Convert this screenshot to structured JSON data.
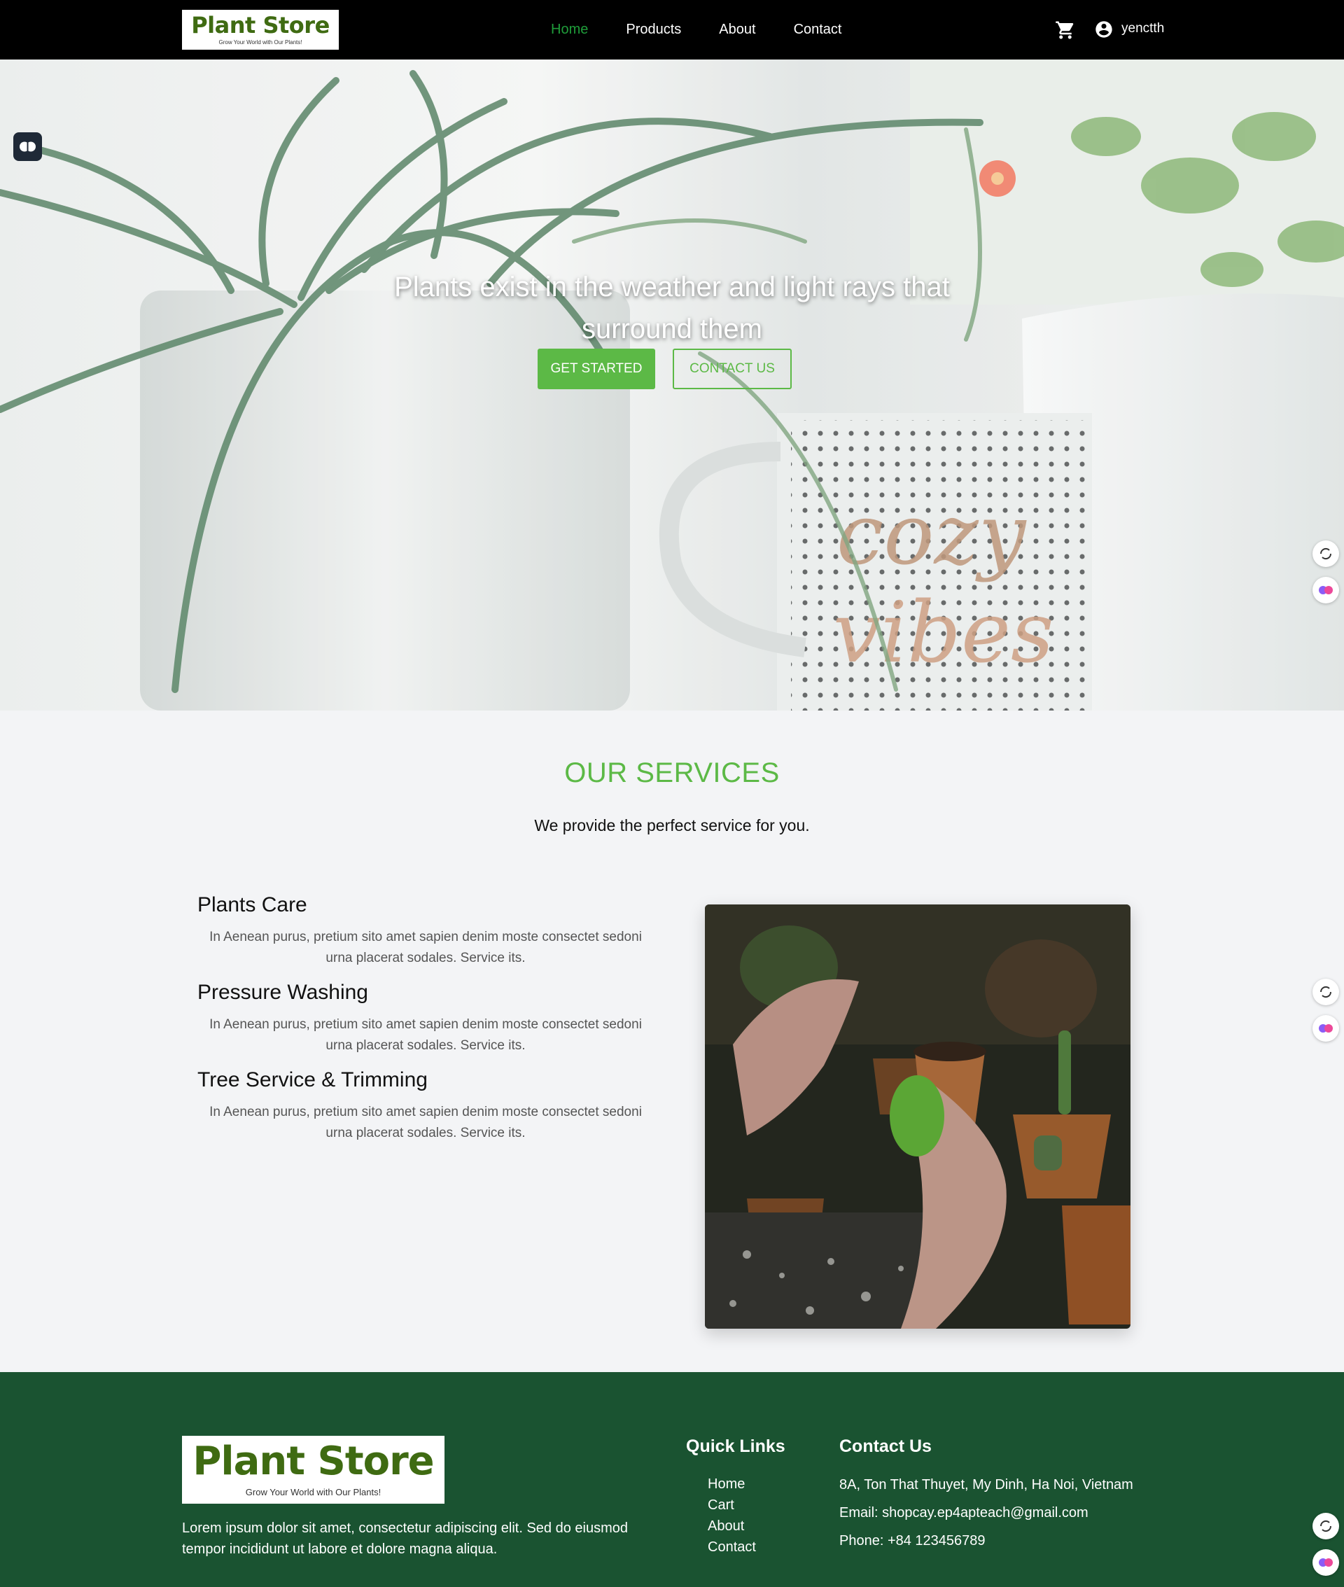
{
  "navbar": {
    "logo_title": "Plant Store",
    "logo_tagline": "Grow Your World with Our Plants!",
    "links": [
      "Home",
      "Products",
      "About",
      "Contact"
    ],
    "active_link": "Home",
    "username": "yenctth",
    "icons": [
      "cart-icon",
      "user-circle-icon"
    ]
  },
  "hero": {
    "title": "Plants exist in the weather and light rays that surround them",
    "get_started": "GET STARTED",
    "contact_us": "CONTACT US",
    "mug_lettering": "cozy vibes"
  },
  "services": {
    "heading": "OUR SERVICES",
    "subtitle": "We provide the perfect service for you.",
    "items": [
      {
        "title": "Plants Care",
        "desc": "In Aenean purus, pretium sito amet sapien denim moste consectet sedoni urna placerat sodales. Service its."
      },
      {
        "title": "Pressure Washing",
        "desc": "In Aenean purus, pretium sito amet sapien denim moste consectet sedoni urna placerat sodales. Service its."
      },
      {
        "title": "Tree Service & Trimming",
        "desc": "In Aenean purus, pretium sito amet sapien denim moste consectet sedoni urna placerat sodales. Service its."
      }
    ]
  },
  "footer": {
    "logo_title": "Plant Store",
    "logo_tagline": "Grow Your World with Our Plants!",
    "description": "Lorem ipsum dolor sit amet, consectetur adipiscing elit. Sed do eiusmod tempor incididunt ut labore et dolore magna aliqua.",
    "quick_links_title": "Quick Links",
    "quick_links": [
      "Home",
      "Cart",
      "About",
      "Contact"
    ],
    "contact_title": "Contact Us",
    "address": "8A, Ton That Thuyet, My Dinh, Ha Noi, Vietnam",
    "email": "Email: shopcay.ep4apteach@gmail.com",
    "phone": "Phone: +84 123456789"
  },
  "colors": {
    "accent_green": "#5cb946",
    "nav_active": "#1f9d3a",
    "footer_bg": "#1a5331",
    "logo_green": "#3f6b12",
    "navbar_bg": "#000000"
  }
}
